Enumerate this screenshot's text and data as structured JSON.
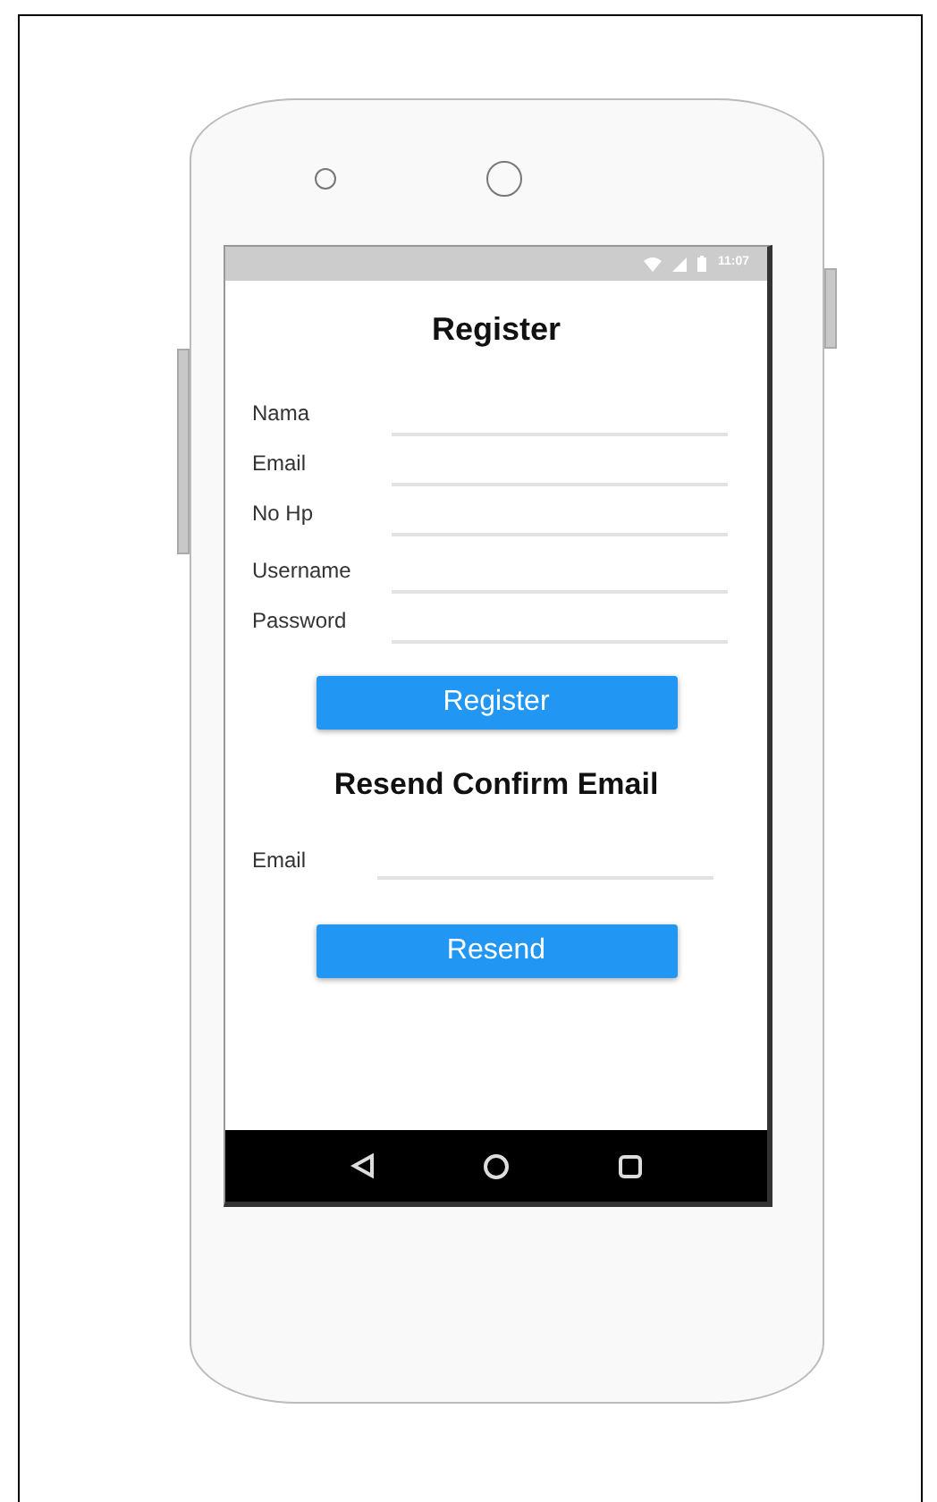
{
  "status_bar": {
    "time": "11:07"
  },
  "register": {
    "title": "Register",
    "fields": [
      {
        "label": "Nama"
      },
      {
        "label": "Email"
      },
      {
        "label": "No Hp"
      },
      {
        "label": "Username"
      },
      {
        "label": "Password"
      }
    ],
    "button": "Register"
  },
  "resend": {
    "title": "Resend Confirm Email",
    "fields": [
      {
        "label": "Email"
      }
    ],
    "button": "Resend"
  }
}
